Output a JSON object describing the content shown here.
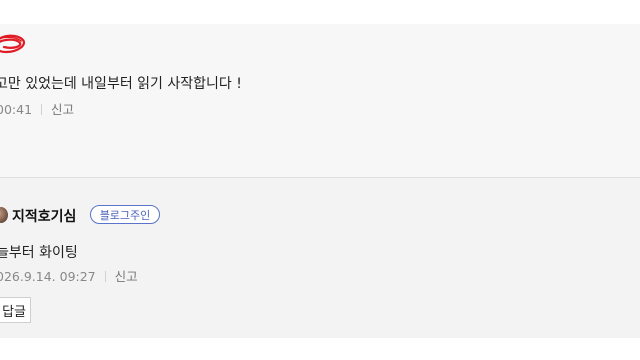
{
  "comments": [
    {
      "text": "고만 있었는데 내일부터 읽기 사작합니다 !",
      "time": "00:41",
      "report_label": "신고",
      "sticker_icon": "red-scribble-sticker-icon"
    },
    {
      "nickname": "지적호기심",
      "badge": "블로그주인",
      "text": "늘부터 화이팅",
      "date": "026.9.14. 09:27",
      "report_label": "신고",
      "reply_button": "답글"
    }
  ],
  "colors": {
    "comment_bg": "#f7f7f7",
    "reply_bg": "#f3f3f3",
    "badge_blue": "#4b63b8",
    "sticker_red": "#e01b24"
  }
}
